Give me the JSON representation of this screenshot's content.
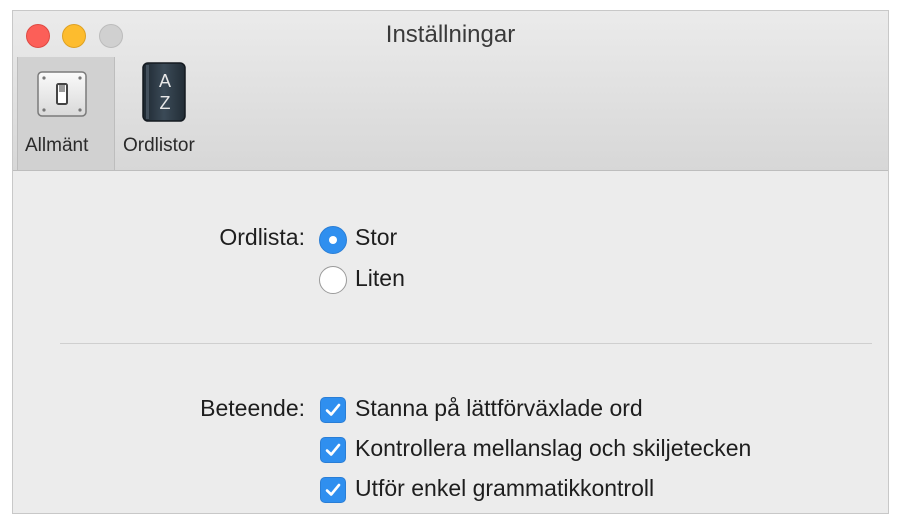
{
  "window": {
    "title": "Inställningar"
  },
  "toolbar": {
    "items": [
      {
        "label": "Allmänt",
        "icon": "switch-icon",
        "selected": true
      },
      {
        "label": "Ordlistor",
        "icon": "dictionary-book-icon",
        "selected": false,
        "icon_text_top": "A",
        "icon_text_bottom": "Z"
      }
    ]
  },
  "dictionary": {
    "label": "Ordlista:",
    "options": [
      {
        "label": "Stor",
        "selected": true
      },
      {
        "label": "Liten",
        "selected": false
      }
    ]
  },
  "behavior": {
    "label": "Beteende:",
    "options": [
      {
        "label": "Stanna på lättförväxlade ord",
        "checked": true
      },
      {
        "label": "Kontrollera mellanslag och skiljetecken",
        "checked": true
      },
      {
        "label": "Utför enkel grammatikkontroll",
        "checked": true
      }
    ]
  },
  "colors": {
    "accent": "#2f8fef",
    "close": "#fc5f58",
    "minimize": "#fdbc2e",
    "zoom_disabled": "#d0d0d0"
  }
}
